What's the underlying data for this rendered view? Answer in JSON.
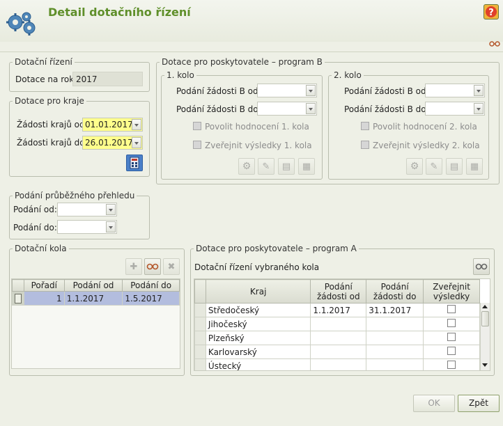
{
  "window": {
    "title": "Detail dotačního řízení"
  },
  "dotacni_rizeni": {
    "legend": "Dotační řízení",
    "year_label": "Dotace na rok:",
    "year_value": "2017"
  },
  "dotace_kraje": {
    "legend": "Dotace pro kraje",
    "from_label": "Žádosti krajů od:",
    "from_value": "01.01.2017",
    "to_label": "Žádosti krajů do:",
    "to_value": "26.01.2017"
  },
  "prubezny": {
    "legend": "Podání průběžného přehledu",
    "from_label": "Podání od:",
    "to_label": "Podání do:"
  },
  "program_b": {
    "legend": "Dotace pro poskytovatele – program B",
    "kolo1": {
      "legend": "1. kolo",
      "from_label": "Podání žádosti B od:",
      "to_label": "Podání žádosti B do:",
      "cb1_label": "Povolit hodnocení 1. kola",
      "cb2_label": "Zveřejnit výsledky 1. kola"
    },
    "kolo2": {
      "legend": "2. kolo",
      "from_label": "Podání žádosti B od:",
      "to_label": "Podání žádosti B do:",
      "cb1_label": "Povolit hodnocení 2. kola",
      "cb2_label": "Zveřejnit výsledky 2. kola"
    }
  },
  "dotacni_kola": {
    "legend": "Dotační kola",
    "columns": [
      "Pořadí",
      "Podání od",
      "Podání do"
    ],
    "rows": [
      {
        "poradi": "1",
        "od": "1.1.2017",
        "do": "1.5.2017"
      }
    ]
  },
  "program_a": {
    "legend": "Dotace pro poskytovatele – program A",
    "subtitle": "Dotační řízení vybraného kola",
    "columns": {
      "kraj": "Kraj",
      "od": "Podání žádosti od",
      "do": "Podání žádosti do",
      "zverejnit": "Zveřejnit výsledky"
    },
    "rows": [
      {
        "kraj": "Středočeský",
        "od": "1.1.2017",
        "do": "31.1.2017"
      },
      {
        "kraj": "Jihočeský",
        "od": "",
        "do": ""
      },
      {
        "kraj": "Plzeňský",
        "od": "",
        "do": ""
      },
      {
        "kraj": "Karlovarský",
        "od": "",
        "do": ""
      },
      {
        "kraj": "Ústecký",
        "od": "",
        "do": ""
      }
    ]
  },
  "footer": {
    "ok_label": "OK",
    "back_label": "Zpět"
  },
  "colors": {
    "accent": "#5f8f2a",
    "highlight": "#ffff8c",
    "selected_row": "#b3bdde"
  },
  "icons": [
    "gears-icon",
    "help-icon",
    "glasses-icon",
    "calculator-icon",
    "add-icon",
    "edit-icon",
    "delete-icon",
    "settings-icon"
  ]
}
